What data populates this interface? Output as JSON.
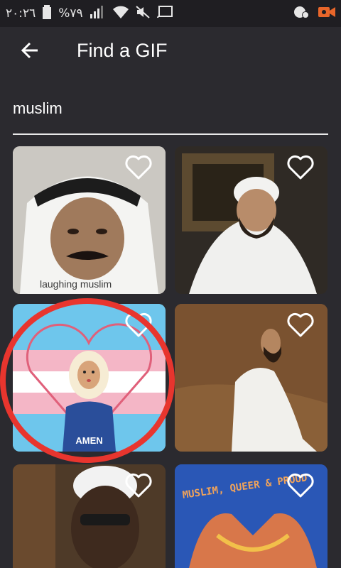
{
  "status_bar": {
    "time": "٢٠:٢٦",
    "battery": "%٧٩"
  },
  "header": {
    "title": "Find a GIF"
  },
  "search": {
    "value": "muslim"
  },
  "gifs": [
    {
      "caption": "laughing muslim"
    },
    {
      "caption": ""
    },
    {
      "caption": "AMEN"
    },
    {
      "caption": ""
    },
    {
      "caption": ""
    },
    {
      "caption": "MUSLIM, QUEER & PROUD"
    }
  ],
  "colors": {
    "background": "#2b2a2f",
    "statusbar": "#1f1e22",
    "highlight_circle": "#e8352e",
    "camera_icon": "#e8662a"
  }
}
